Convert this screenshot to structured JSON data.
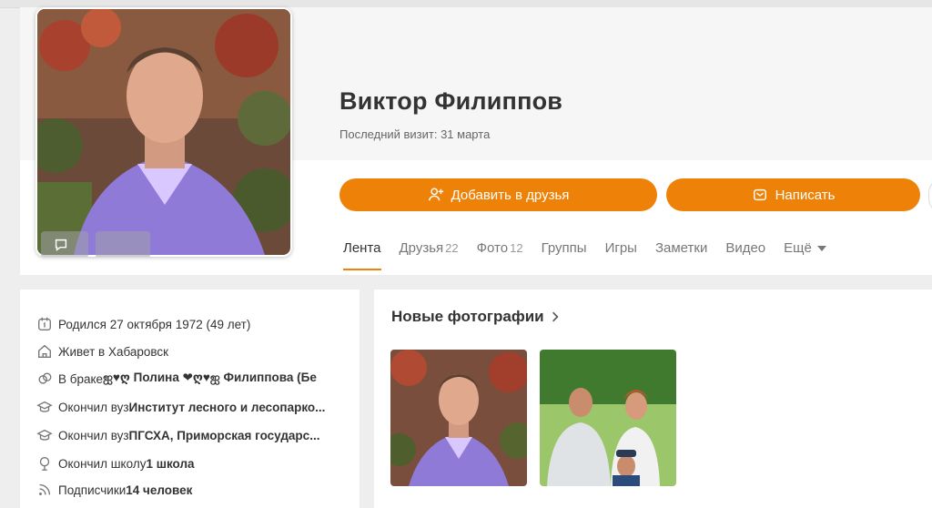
{
  "profile": {
    "name": "Виктор Филиппов",
    "last_visit": "Последний визит: 31 марта"
  },
  "actions": {
    "add_friend": "Добавить в друзья",
    "message": "Написать"
  },
  "tabs": [
    {
      "label": "Лента",
      "count": ""
    },
    {
      "label": "Друзья",
      "count": "22"
    },
    {
      "label": "Фото",
      "count": "12"
    },
    {
      "label": "Группы",
      "count": ""
    },
    {
      "label": "Игры",
      "count": ""
    },
    {
      "label": "Заметки",
      "count": ""
    },
    {
      "label": "Видео",
      "count": ""
    },
    {
      "label": "Ещё",
      "count": ""
    }
  ],
  "info": {
    "born": "Родился 27 октября 1972 (49 лет)",
    "lives": "Живет в Хабаровск",
    "married_prefix": "В браке ",
    "married_value": "ஐ♥ღ Полина ❤ღ♥ஐ Филиппова (Бе",
    "uni1_prefix": "Окончил вуз ",
    "uni1_value": "Институт лесного и лесопарко...",
    "uni2_prefix": "Окончил вуз ",
    "uni2_value": "ПГСХА, Приморская государс...",
    "school_prefix": "Окончил школу ",
    "school_value": "1 школа",
    "subs_prefix": "Подписчики ",
    "subs_value": "14 человек"
  },
  "photos": {
    "title": "Новые фотографии"
  },
  "colors": {
    "accent": "#ee8208"
  }
}
